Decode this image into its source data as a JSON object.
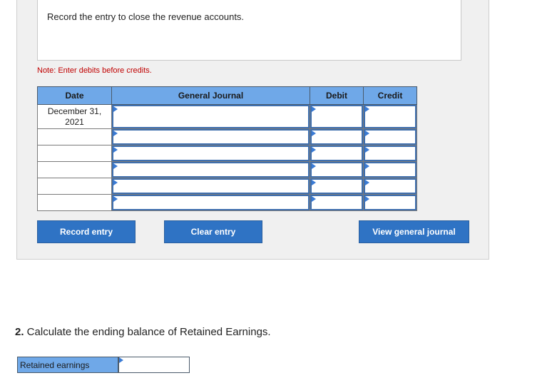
{
  "instruction": "Record the entry to close the revenue accounts.",
  "note": "Note: Enter debits before credits.",
  "journal": {
    "headers": {
      "date": "Date",
      "general_journal": "General Journal",
      "debit": "Debit",
      "credit": "Credit"
    },
    "rows": [
      {
        "date": "December 31, 2021"
      },
      {
        "date": ""
      },
      {
        "date": ""
      },
      {
        "date": ""
      },
      {
        "date": ""
      },
      {
        "date": ""
      }
    ]
  },
  "buttons": {
    "record": "Record entry",
    "clear": "Clear entry",
    "view": "View general journal"
  },
  "question2": {
    "number": "2.",
    "text": " Calculate the ending balance of Retained Earnings."
  },
  "retained": {
    "label": "Retained earnings",
    "value": ""
  },
  "colors": {
    "header_blue": "#6fa8e8",
    "button_blue": "#2f73c4",
    "note_red": "#c00000"
  }
}
